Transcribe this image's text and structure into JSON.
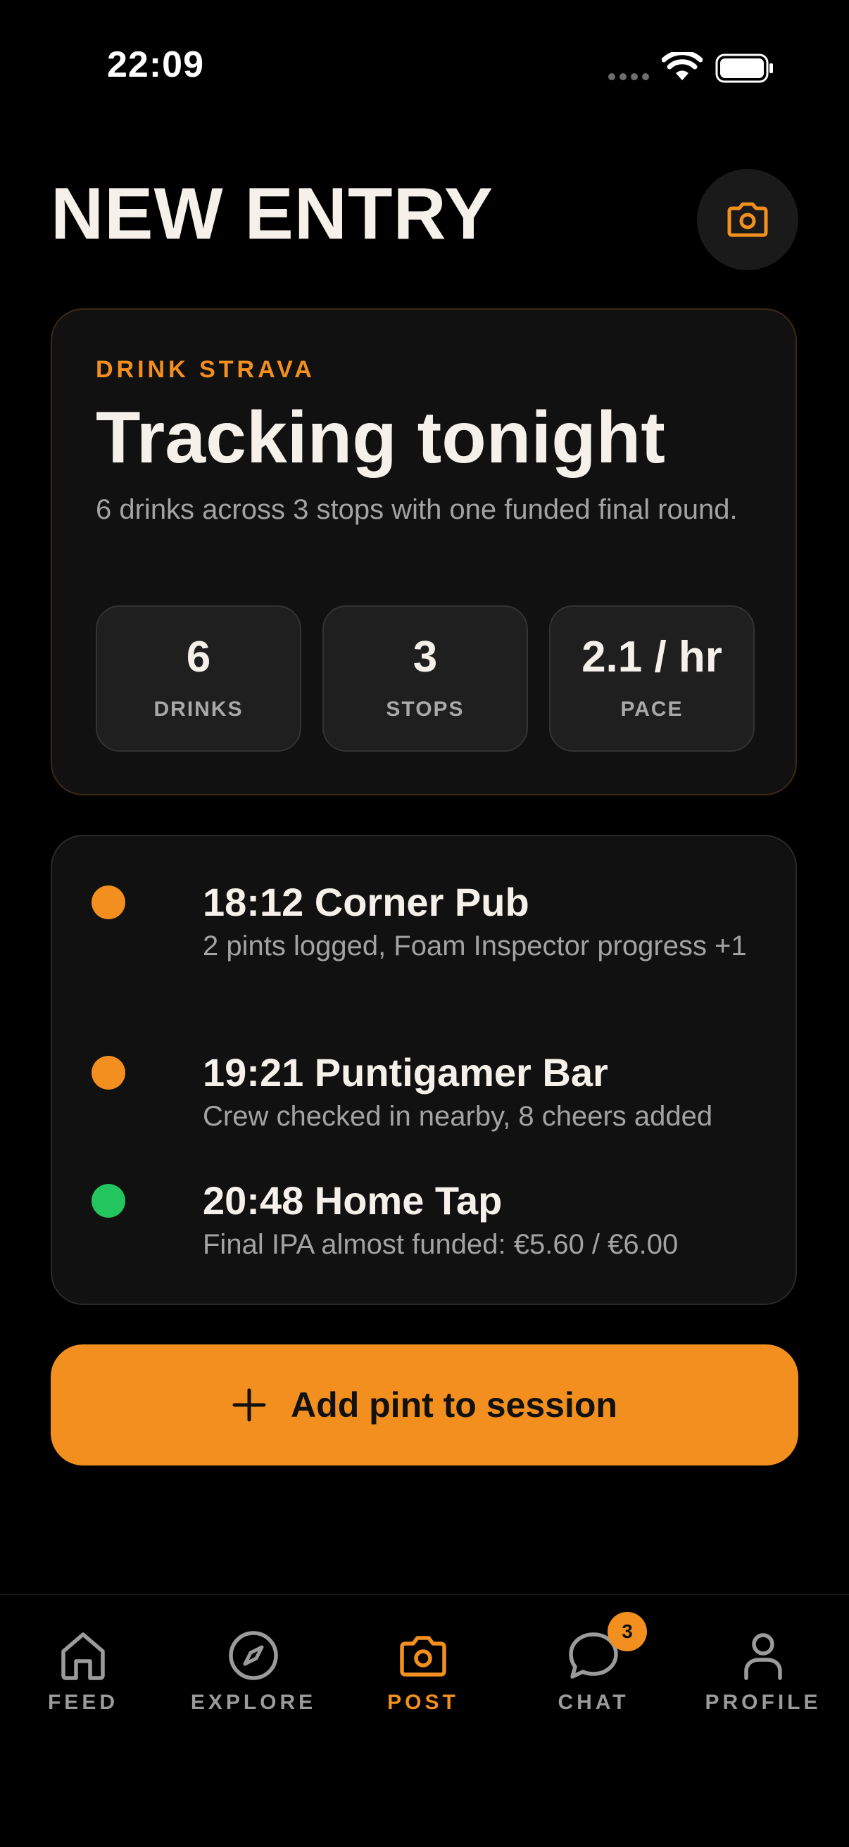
{
  "status_bar": {
    "time": "22:09"
  },
  "header": {
    "title": "NEW ENTRY",
    "camera_icon": "camera-icon"
  },
  "summary": {
    "eyebrow": "DRINK STRAVA",
    "headline": "Tracking tonight",
    "subtitle": "6 drinks across 3 stops with one funded final round.",
    "stats": [
      {
        "value": "6",
        "label": "DRINKS"
      },
      {
        "value": "3",
        "label": "STOPS"
      },
      {
        "value": "2.1 / hr",
        "label": "PACE"
      }
    ]
  },
  "timeline": [
    {
      "title": "18:12 Corner Pub",
      "description": "2 pints logged, Foam Inspector progress +1",
      "dot_color": "#f28f1f"
    },
    {
      "title": "19:21 Puntigamer Bar",
      "description": "Crew checked in nearby, 8 cheers added",
      "dot_color": "#f28f1f"
    },
    {
      "title": "20:48 Home Tap",
      "description": "Final IPA almost funded: €5.60 / €6.00",
      "dot_color": "#22c55e"
    }
  ],
  "add_button": {
    "label": "Add pint to session",
    "icon": "plus-icon"
  },
  "tabs": [
    {
      "label": "FEED",
      "icon": "home-icon"
    },
    {
      "label": "EXPLORE",
      "icon": "compass-icon"
    },
    {
      "label": "POST",
      "icon": "camera-icon",
      "active": true
    },
    {
      "label": "CHAT",
      "icon": "chat-bubble-icon",
      "badge": "3"
    },
    {
      "label": "PROFILE",
      "icon": "person-icon"
    }
  ],
  "colors": {
    "accent": "#f28f1f",
    "success": "#22c55e",
    "background": "#000000",
    "card": "#111111"
  }
}
